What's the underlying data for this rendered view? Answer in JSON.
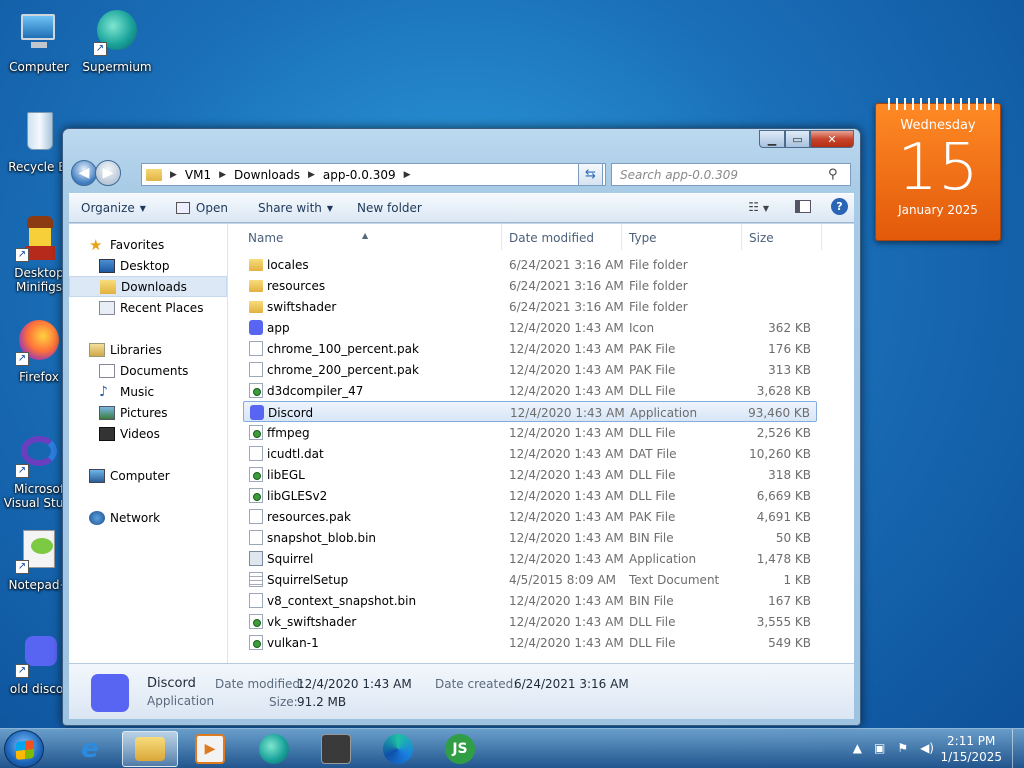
{
  "desktop": {
    "icons": [
      {
        "label": "Computer"
      },
      {
        "label": "Supermium"
      },
      {
        "label": "Recycle Bi"
      },
      {
        "label": "Desktop Minifigs"
      },
      {
        "label": "Firefox"
      },
      {
        "label": "Microsof Visual Studi"
      },
      {
        "label": "Notepad+"
      },
      {
        "label": "old discor"
      }
    ]
  },
  "calendar": {
    "weekday": "Wednesday",
    "day": "15",
    "month_year": "January 2025"
  },
  "window": {
    "address": {
      "crumbs": [
        "VM1",
        "Downloads",
        "app-0.0.309"
      ]
    },
    "search_placeholder": "Search app-0.0.309",
    "toolbar": {
      "organize": "Organize",
      "open": "Open",
      "share_with": "Share with",
      "new_folder": "New folder"
    },
    "nav": {
      "favorites": "Favorites",
      "desktop": "Desktop",
      "downloads": "Downloads",
      "recent": "Recent Places",
      "libraries": "Libraries",
      "documents": "Documents",
      "music": "Music",
      "pictures": "Pictures",
      "videos": "Videos",
      "computer": "Computer",
      "network": "Network"
    },
    "columns": {
      "name": "Name",
      "date": "Date modified",
      "type": "Type",
      "size": "Size"
    },
    "files": [
      {
        "name": "locales",
        "date": "6/24/2021 3:16 AM",
        "type": "File folder",
        "size": "",
        "icon": "folder"
      },
      {
        "name": "resources",
        "date": "6/24/2021 3:16 AM",
        "type": "File folder",
        "size": "",
        "icon": "folder"
      },
      {
        "name": "swiftshader",
        "date": "6/24/2021 3:16 AM",
        "type": "File folder",
        "size": "",
        "icon": "folder"
      },
      {
        "name": "app",
        "date": "12/4/2020 1:43 AM",
        "type": "Icon",
        "size": "362 KB",
        "icon": "discord"
      },
      {
        "name": "chrome_100_percent.pak",
        "date": "12/4/2020 1:43 AM",
        "type": "PAK File",
        "size": "176 KB",
        "icon": "file"
      },
      {
        "name": "chrome_200_percent.pak",
        "date": "12/4/2020 1:43 AM",
        "type": "PAK File",
        "size": "313 KB",
        "icon": "file"
      },
      {
        "name": "d3dcompiler_47",
        "date": "12/4/2020 1:43 AM",
        "type": "DLL File",
        "size": "3,628 KB",
        "icon": "dll"
      },
      {
        "name": "Discord",
        "date": "12/4/2020 1:43 AM",
        "type": "Application",
        "size": "93,460 KB",
        "icon": "discord",
        "selected": true
      },
      {
        "name": "ffmpeg",
        "date": "12/4/2020 1:43 AM",
        "type": "DLL File",
        "size": "2,526 KB",
        "icon": "dll"
      },
      {
        "name": "icudtl.dat",
        "date": "12/4/2020 1:43 AM",
        "type": "DAT File",
        "size": "10,260 KB",
        "icon": "file"
      },
      {
        "name": "libEGL",
        "date": "12/4/2020 1:43 AM",
        "type": "DLL File",
        "size": "318 KB",
        "icon": "dll"
      },
      {
        "name": "libGLESv2",
        "date": "12/4/2020 1:43 AM",
        "type": "DLL File",
        "size": "6,669 KB",
        "icon": "dll"
      },
      {
        "name": "resources.pak",
        "date": "12/4/2020 1:43 AM",
        "type": "PAK File",
        "size": "4,691 KB",
        "icon": "file"
      },
      {
        "name": "snapshot_blob.bin",
        "date": "12/4/2020 1:43 AM",
        "type": "BIN File",
        "size": "50 KB",
        "icon": "file"
      },
      {
        "name": "Squirrel",
        "date": "12/4/2020 1:43 AM",
        "type": "Application",
        "size": "1,478 KB",
        "icon": "app"
      },
      {
        "name": "SquirrelSetup",
        "date": "4/5/2015 8:09 AM",
        "type": "Text Document",
        "size": "1 KB",
        "icon": "txt"
      },
      {
        "name": "v8_context_snapshot.bin",
        "date": "12/4/2020 1:43 AM",
        "type": "BIN File",
        "size": "167 KB",
        "icon": "file"
      },
      {
        "name": "vk_swiftshader",
        "date": "12/4/2020 1:43 AM",
        "type": "DLL File",
        "size": "3,555 KB",
        "icon": "dll"
      },
      {
        "name": "vulkan-1",
        "date": "12/4/2020 1:43 AM",
        "type": "DLL File",
        "size": "549 KB",
        "icon": "dll"
      }
    ],
    "details": {
      "name": "Discord",
      "type": "Application",
      "modified_label": "Date modified:",
      "modified_value": "12/4/2020 1:43 AM",
      "created_label": "Date created:",
      "created_value": "6/24/2021 3:16 AM",
      "size_label": "Size:",
      "size_value": "91.2 MB"
    }
  },
  "taskbar": {
    "time": "2:11 PM",
    "date": "1/15/2025",
    "js_label": "JS"
  }
}
